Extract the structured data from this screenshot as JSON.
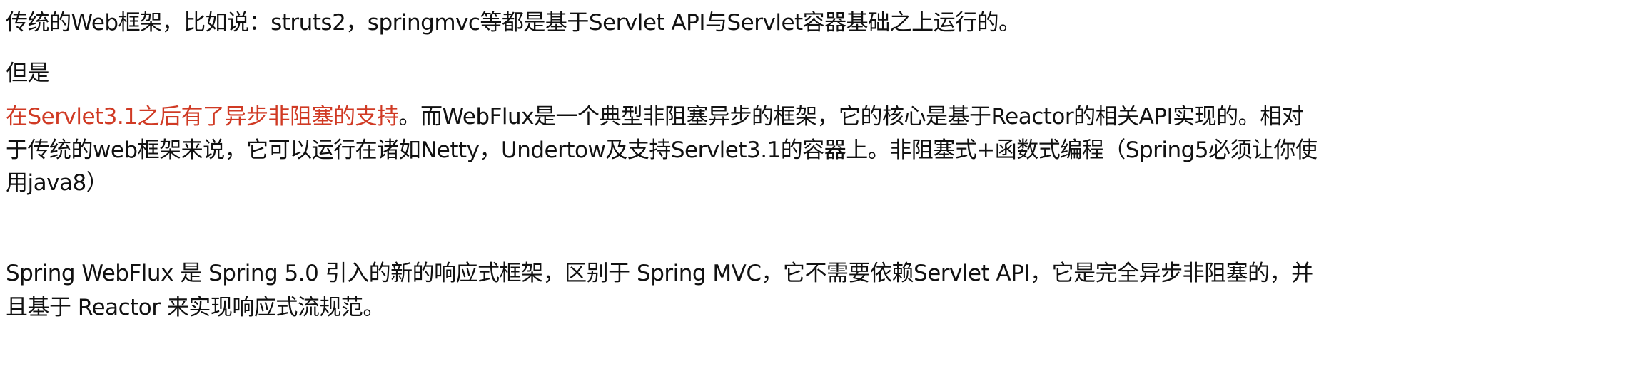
{
  "paragraphs": {
    "p1": "传统的Web框架，比如说：struts2，springmvc等都是基于Servlet API与Servlet容器基础之上运行的。",
    "p2": "但是",
    "p3": {
      "highlight": "在Servlet3.1之后有了异步非阻塞的支持",
      "line1_rest": "。而WebFlux是一个典型非阻塞异步的框架，它的核心是基于Reactor的相关API实现的。相对",
      "line2": "于传统的web框架来说，它可以运行在诸如Netty，Undertow及支持Servlet3.1的容器上。非阻塞式+函数式编程（Spring5必须让你使",
      "line3": "用java8）"
    },
    "p4": {
      "line1": "Spring WebFlux 是 Spring 5.0 引入的新的响应式框架，区别于 Spring MVC，它不需要依赖Servlet API，它是完全异步非阻塞的，并",
      "line2": "且基于 Reactor 来实现响应式流规范。"
    }
  },
  "colors": {
    "text": "#111111",
    "highlight": "#d03a24"
  }
}
